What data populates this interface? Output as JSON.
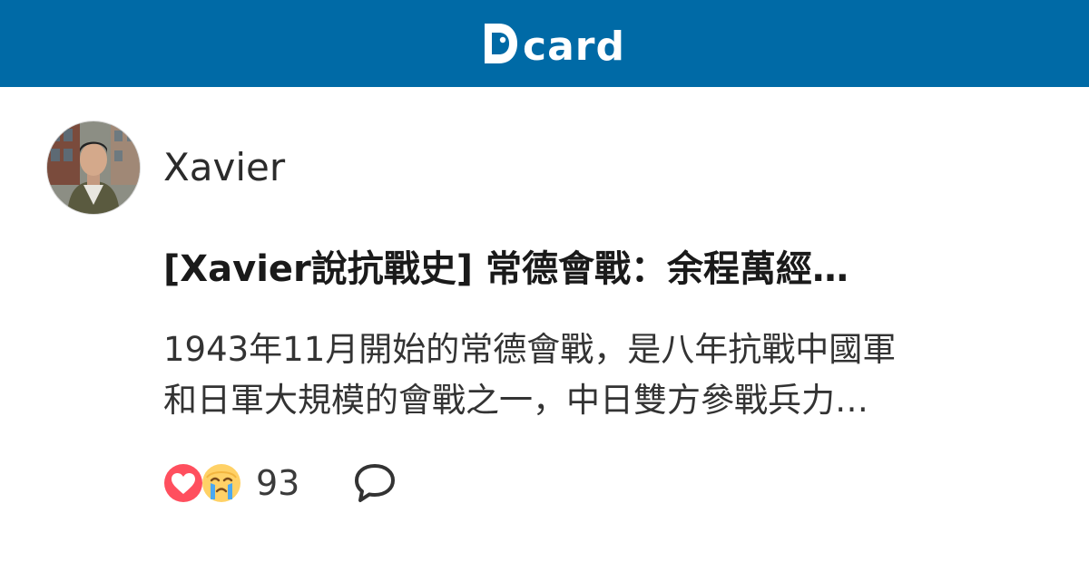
{
  "brand": {
    "name": "Dcard",
    "wordmark_text": "card",
    "header_color": "#006aa6"
  },
  "post": {
    "author": "Xavier",
    "title": "[Xavier說抗戰史] 常德會戰：余程萬經…",
    "excerpt_lines": [
      "1943年11月開始的常德會戰，是八年抗戰中國軍",
      "和日軍大規模的會戰之一，中日雙方參戰兵力…"
    ],
    "reactions": [
      "heart-icon",
      "crying-face-icon"
    ],
    "reaction_count": "93",
    "comment_icon": "comment-bubble-icon"
  }
}
